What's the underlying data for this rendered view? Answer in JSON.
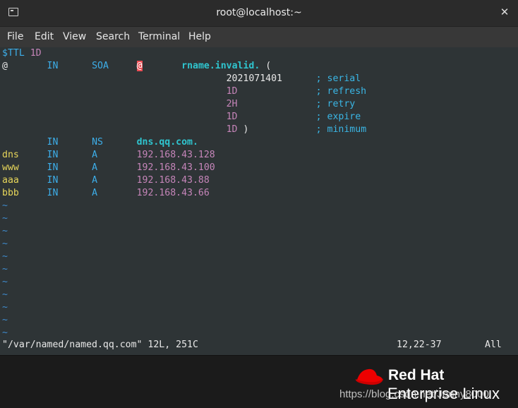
{
  "window": {
    "title": "root@localhost:~"
  },
  "menu": [
    "File",
    "Edit",
    "View",
    "Search",
    "Terminal",
    "Help"
  ],
  "editor": {
    "line1": {
      "ttl": "$TTL",
      "ttl_val": "1D"
    },
    "line2": {
      "at": "@",
      "class": "IN",
      "type": "SOA",
      "cursor_char": "@",
      "rname": "rname.invalid.",
      "paren": "("
    },
    "soa": [
      {
        "value": "2021071401",
        "comment": "; serial"
      },
      {
        "value": "1D",
        "comment": "; refresh"
      },
      {
        "value": "2H",
        "comment": "; retry"
      },
      {
        "value": "1D",
        "comment": "; expire"
      },
      {
        "value": "1D",
        "close": ")",
        "comment": "; minimum"
      }
    ],
    "ns": {
      "class": "IN",
      "type": "NS",
      "value": "dns.qq.com."
    },
    "records": [
      {
        "name": "dns",
        "class": "IN",
        "type": "A",
        "value": "192.168.43.128"
      },
      {
        "name": "www",
        "class": "IN",
        "type": "A",
        "value": "192.168.43.100"
      },
      {
        "name": "aaa",
        "class": "IN",
        "type": "A",
        "value": "192.168.43.88"
      },
      {
        "name": "bbb",
        "class": "IN",
        "type": "A",
        "value": "192.168.43.66"
      }
    ],
    "tilde": "~",
    "status": {
      "file": "\"/var/named/named.qq.com\" 12L, 251C",
      "position": "12,22-37",
      "scroll": "All"
    }
  },
  "desktop": {
    "brand_line1": "Red Hat",
    "brand_line2": "Enterprise Linux",
    "watermark": "https://blog.csdn.net/Jenny8000"
  },
  "colors": {
    "editor_bg": "#2e3436",
    "cursor": "#ea4d54",
    "keyword": "#3daee9",
    "host": "#e7d65a",
    "ip": "#c585b9"
  }
}
